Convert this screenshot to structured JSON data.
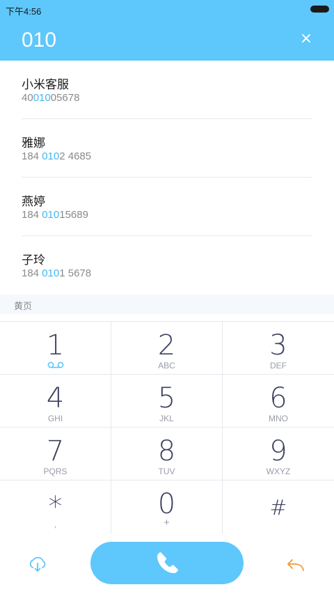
{
  "status_bar": {
    "time": "下午4:56"
  },
  "dialer": {
    "input": "010",
    "clear_symbol": "×"
  },
  "results": [
    {
      "name": "小米客服",
      "number_pre": "40",
      "number_match": "010",
      "number_post": "05678"
    },
    {
      "name": "雅娜",
      "number_pre": "184 ",
      "number_match": "010",
      "number_post": "2 4685"
    },
    {
      "name": "燕婷",
      "number_pre": "184 ",
      "number_match": "010",
      "number_post": "15689"
    },
    {
      "name": "子玲",
      "number_pre": "184 ",
      "number_match": "010",
      "number_post": "1 5678"
    }
  ],
  "yellow_pages": {
    "label": "黄页"
  },
  "keypad": [
    {
      "digit": "1",
      "letters": "",
      "icon": "voicemail-icon"
    },
    {
      "digit": "2",
      "letters": "ABC"
    },
    {
      "digit": "3",
      "letters": "DEF"
    },
    {
      "digit": "4",
      "letters": "GHI"
    },
    {
      "digit": "5",
      "letters": "JKL"
    },
    {
      "digit": "6",
      "letters": "MNO"
    },
    {
      "digit": "7",
      "letters": "PQRS"
    },
    {
      "digit": "8",
      "letters": "TUV"
    },
    {
      "digit": "9",
      "letters": "WXYZ"
    },
    {
      "digit": "*",
      "letters": ","
    },
    {
      "digit": "0",
      "letters": "+"
    },
    {
      "digit": "#",
      "letters": ""
    }
  ],
  "bottom_bar": {
    "left_icon": "download-icon",
    "call_icon": "phone-icon",
    "right_icon": "back-arrow-icon"
  },
  "colors": {
    "accent": "#5ec7fb",
    "highlight": "#3fb7f3",
    "back_arrow": "#f0953a"
  }
}
